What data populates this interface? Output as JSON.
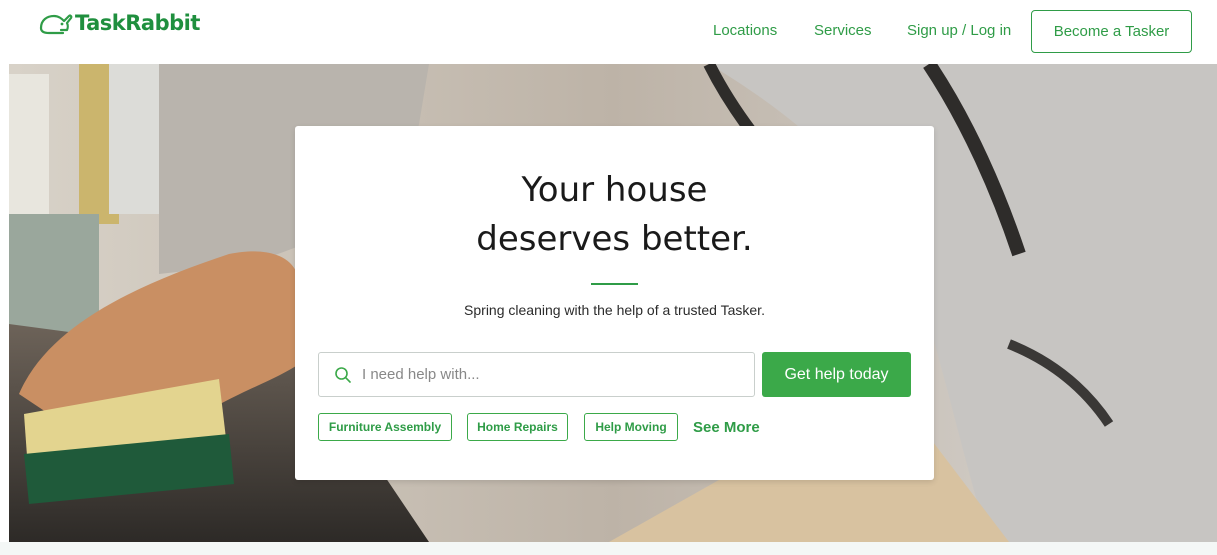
{
  "header": {
    "brand": "TaskRabbit",
    "nav": [
      "Locations",
      "Services",
      "Sign up / Log in"
    ],
    "cta_label": "Become a Tasker"
  },
  "hero": {
    "headline_line1": "Your house",
    "headline_line2": "deserves better.",
    "subtitle": "Spring cleaning with the help of a trusted Tasker.",
    "search_placeholder": "I need help with...",
    "search_button": "Get help today",
    "chips": [
      "Furniture Assembly",
      "Home Repairs",
      "Help Moving"
    ],
    "see_more": "See More"
  },
  "colors": {
    "brand_green": "#2f9c47",
    "button_green": "#3ba949"
  },
  "icons": [
    "rabbit-logo-icon",
    "search-icon"
  ]
}
